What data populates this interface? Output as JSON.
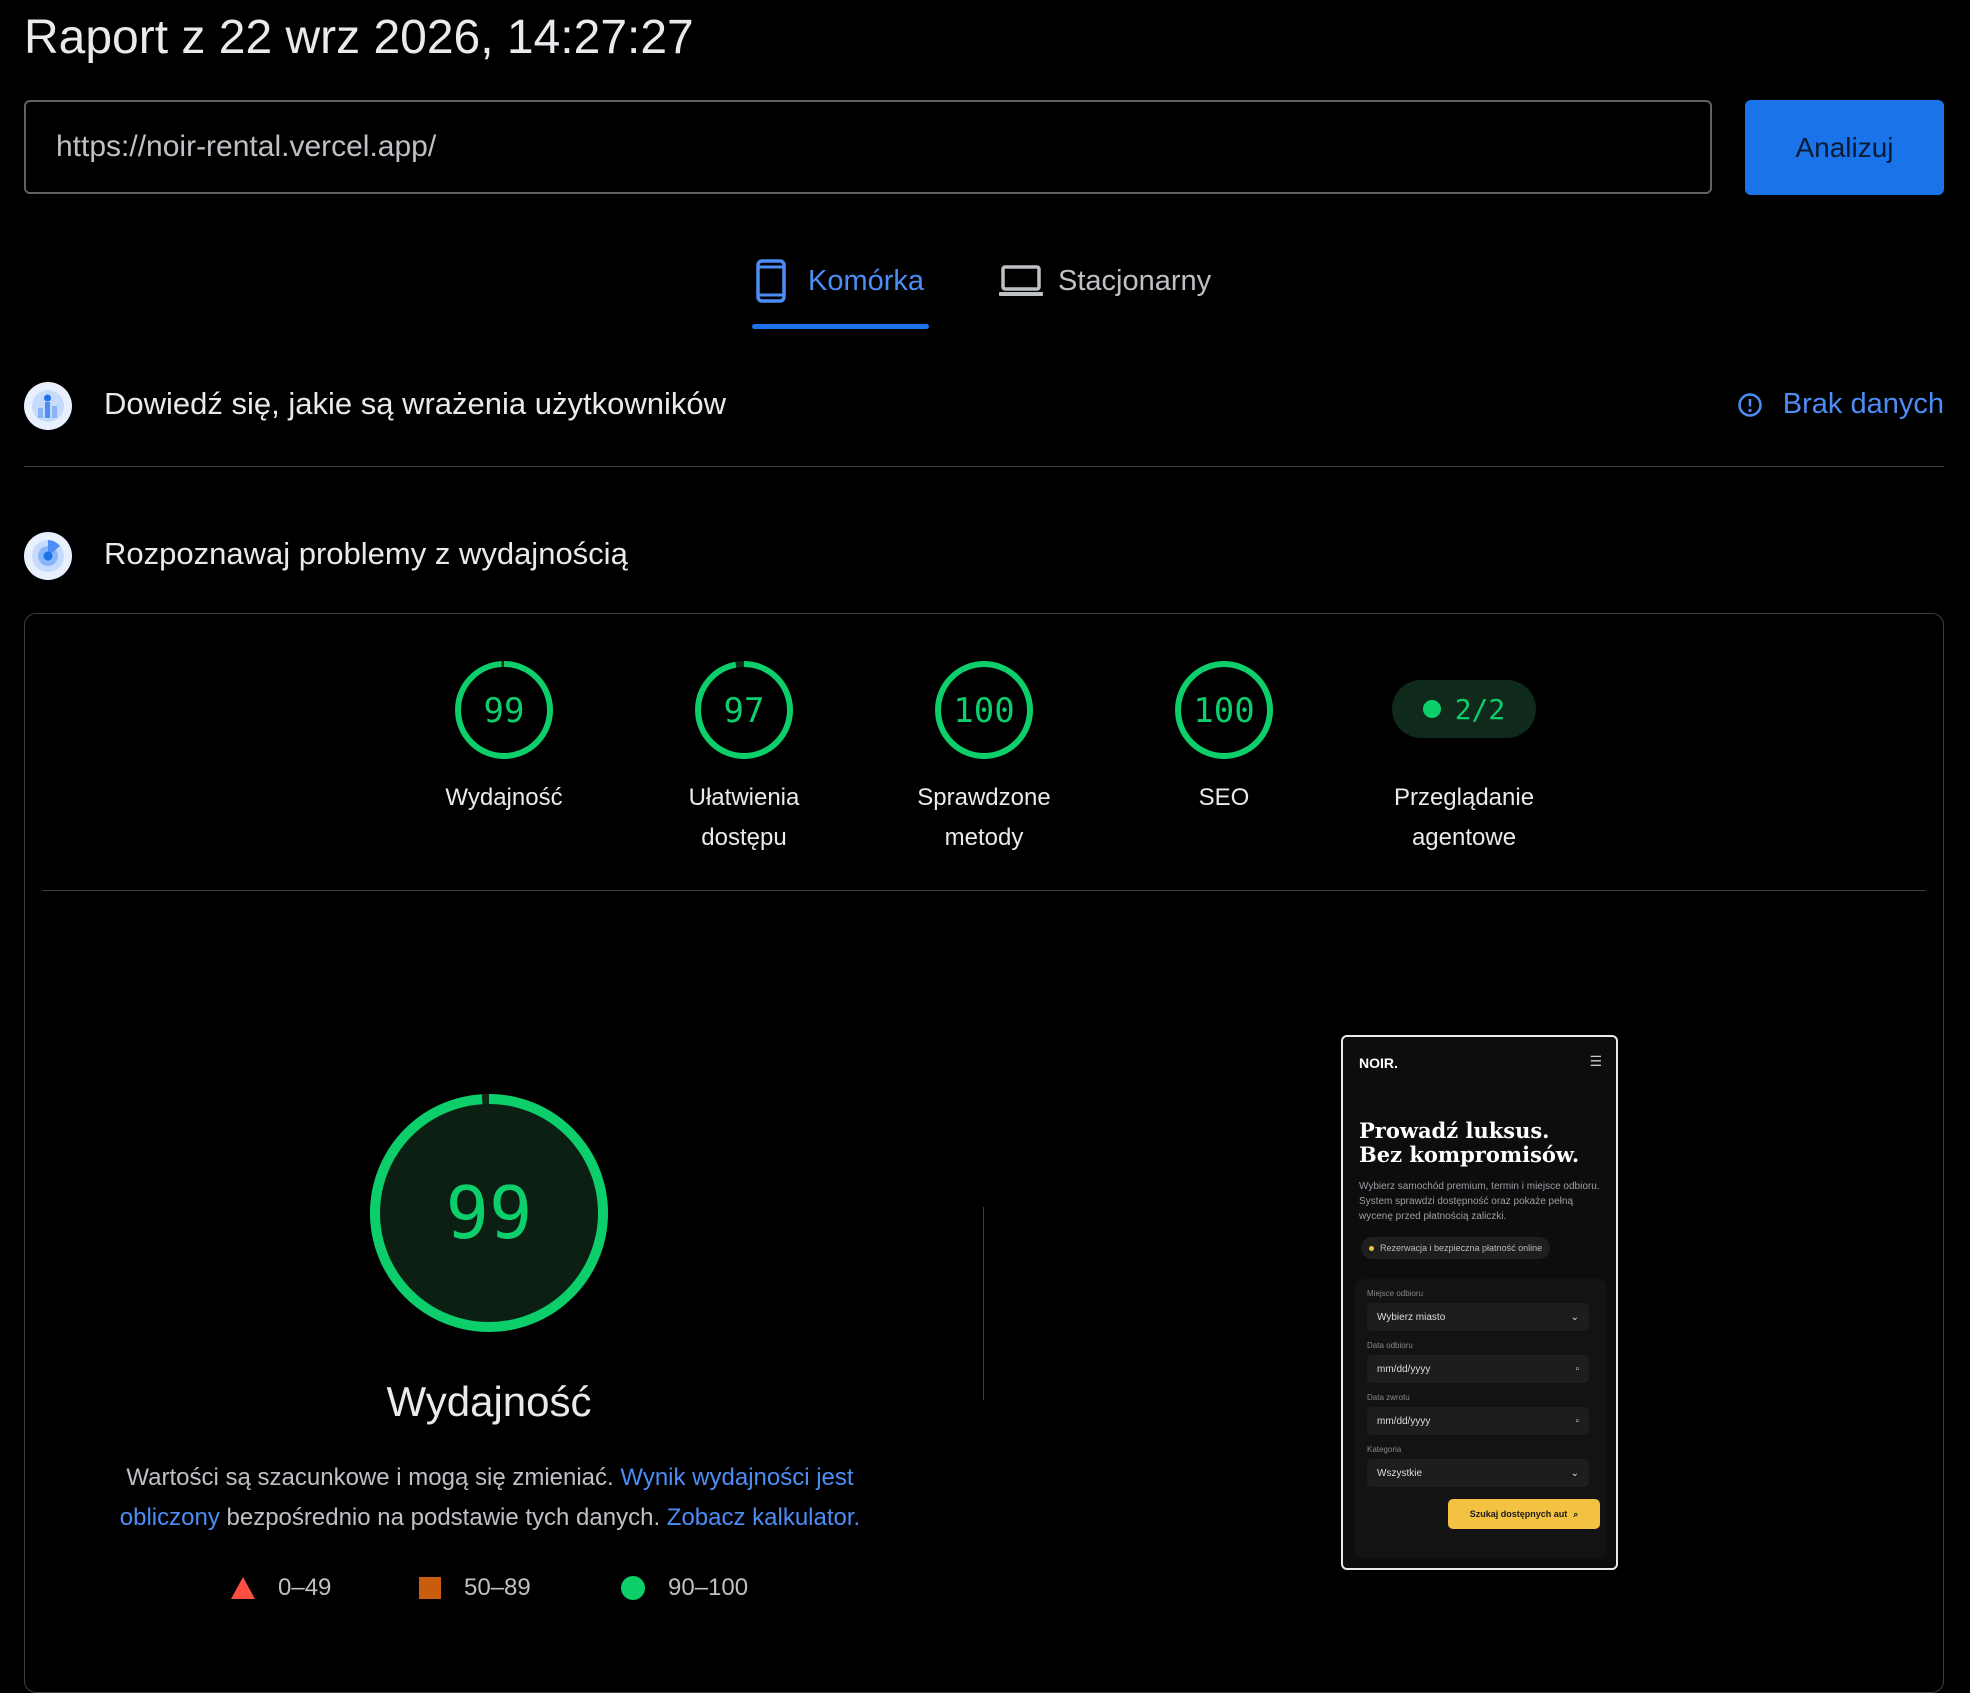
{
  "report": {
    "title": "Raport z 22 wrz 2026, 14:27:27"
  },
  "search": {
    "url": "https://noir-rental.vercel.app/",
    "analyze_label": "Analizuj"
  },
  "tabs": [
    {
      "label": "Komórka",
      "active": true,
      "icon": "smartphone-icon"
    },
    {
      "label": "Stacjonarny",
      "active": false,
      "icon": "laptop-icon"
    }
  ],
  "sections": {
    "field": {
      "title": "Dowiedź się, jakie są wrażenia użytkowników",
      "status": "Brak danych",
      "icon": "crux-icon"
    },
    "lab": {
      "title": "Rozpoznawaj problemy z wydajnością",
      "icon": "lighthouse-icon"
    }
  },
  "categories": [
    {
      "score": "99",
      "value": 99,
      "label": "Wydajność"
    },
    {
      "score": "97",
      "value": 97,
      "label": "Ułatwienia dostępu"
    },
    {
      "score": "100",
      "value": 100,
      "label": "Sprawdzone metody"
    },
    {
      "score": "100",
      "value": 100,
      "label": "SEO"
    }
  ],
  "agentic": {
    "value": "2/2",
    "label": "Przeglądanie agentowe"
  },
  "performance": {
    "score": "99",
    "value": 99,
    "label": "Wydajność",
    "desc_part1": "Wartości są szacunkowe i mogą się zmieniać. ",
    "desc_link1": "Wynik wydajności jest obliczony",
    "desc_part2": " bezpośrednio na podstawie tych danych. ",
    "desc_link2": "Zobacz kalkulator."
  },
  "legend": [
    {
      "range": "0–49",
      "shape": "triangle",
      "color": "#ff4e42"
    },
    {
      "range": "50–89",
      "shape": "square",
      "color": "#c85e0d"
    },
    {
      "range": "90–100",
      "shape": "circle",
      "color": "#0cce6b"
    }
  ],
  "colors": {
    "accent": "#1a73e8",
    "good": "#0cce6b",
    "link": "#4c8df6"
  },
  "screenshot": {
    "logo": "NOIR.",
    "headline": "Prowadź luksus. Bez kompromisów.",
    "subtext": "Wybierz samochód premium, termin i miejsce odbioru. System sprawdzi dostępność oraz pokaże pełną wycenę przed płatnością zaliczki.",
    "pill": "Rezerwacja i bezpieczna płatność online",
    "pickup_label": "Miejsce odbioru",
    "pickup_value": "Wybierz miasto",
    "date_from_label": "Data odbioru",
    "date_from_value": "mm/dd/yyyy",
    "date_to_label": "Data zwrotu",
    "date_to_value": "mm/dd/yyyy",
    "category_label": "Kategoria",
    "category_value": "Wszystkie",
    "search_button": "Szukaj dostępnych aut"
  }
}
